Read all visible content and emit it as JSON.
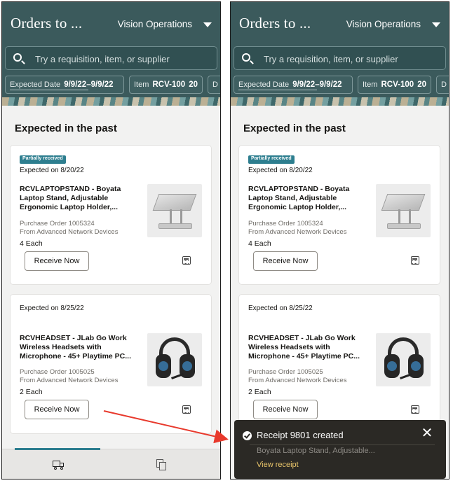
{
  "header": {
    "title": "Orders to ...",
    "org": "Vision Operations",
    "search_placeholder": "Try a requisition, item, or supplier",
    "filters": [
      {
        "label": "Expected Date",
        "value": "9/9/22–9/9/22"
      },
      {
        "label": "Item",
        "value": "RCV-100",
        "extra": "20"
      },
      {
        "label": "D",
        "value": ""
      }
    ]
  },
  "section_title": "Expected in the past",
  "orders": [
    {
      "badge": "Partially received",
      "expected": "Expected on 8/20/22",
      "name": "RCVLAPTOPSTAND - Boyata Laptop Stand, Adjustable Ergonomic Laptop Holder,...",
      "po": "Purchase Order 1005324",
      "supplier": "From Advanced Network Devices",
      "qty": "4 Each",
      "action": "Receive Now"
    },
    {
      "badge": "",
      "expected": "Expected on 8/25/22",
      "name": "RCVHEADSET - JLab Go Work Wireless Headsets with Microphone - 45+ Playtime PC...",
      "po": "Purchase Order 1005025",
      "supplier": "From Advanced Network Devices",
      "qty": "2 Each",
      "action": "Receive Now"
    }
  ],
  "toast": {
    "title": "Receipt 9801 created",
    "subtitle": "Boyata Laptop Stand, Adjustable...",
    "link": "View receipt",
    "close": "✕"
  },
  "icons": {
    "search": "search-icon",
    "dropdown": "chevron-down-icon",
    "calculator": "calculator-icon",
    "truck": "truck-icon",
    "documents": "documents-icon",
    "success": "check-circle-icon",
    "close": "close-icon"
  },
  "colors": {
    "header_bg": "#3b5a5c",
    "accent": "#2d7e8f",
    "toast_bg": "#2b2925",
    "toast_link": "#e9c56a",
    "annotation_arrow": "#e8392c"
  }
}
